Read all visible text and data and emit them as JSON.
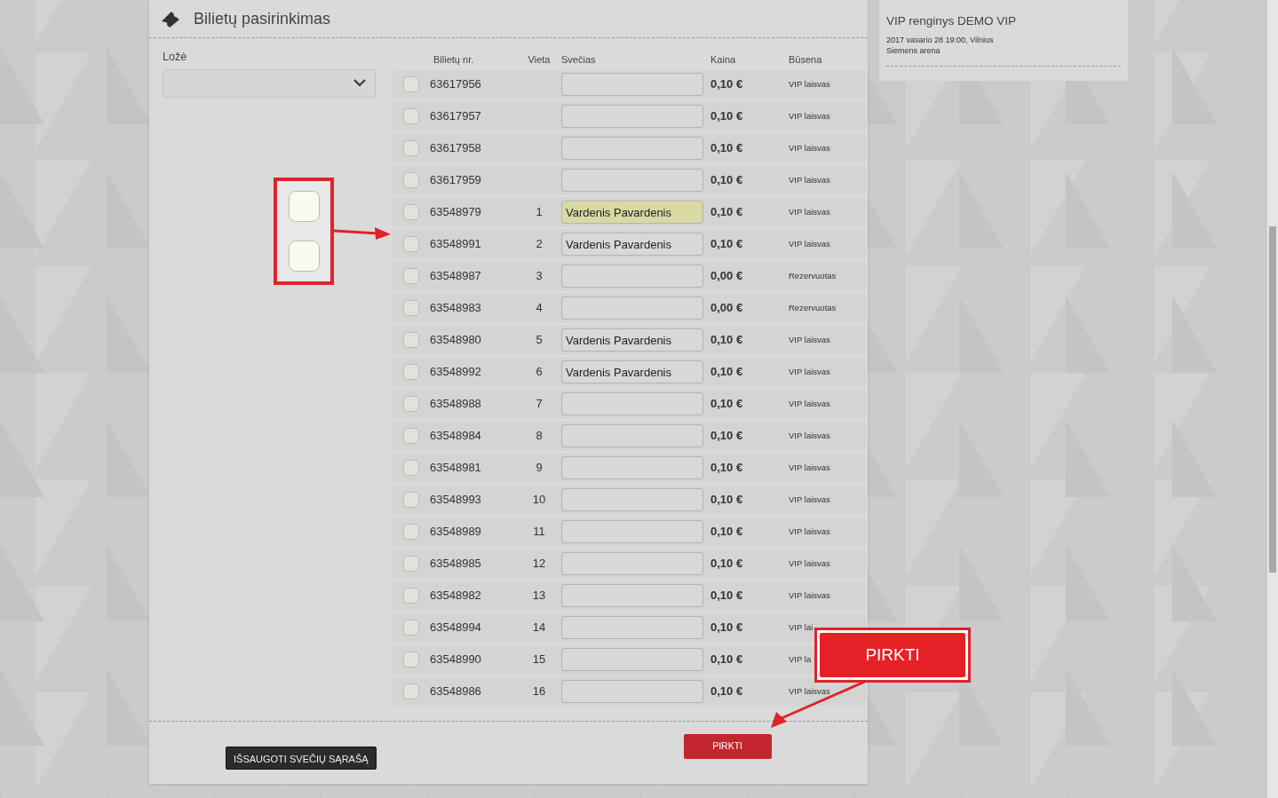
{
  "header": {
    "title": "Bilietų pasirinkimas"
  },
  "loze": {
    "label": "Ložė"
  },
  "table": {
    "columns": [
      "Bilietų nr.",
      "Vieta",
      "Svečias",
      "Kaina",
      "Būsena"
    ],
    "rows": [
      {
        "ticket": "63617956",
        "checked": false,
        "highlighted": false,
        "price": "0,10 €",
        "status": "VIP laisvas"
      },
      {
        "ticket": "63617957",
        "checked": false,
        "highlighted": false,
        "price": "0,10 €",
        "status": "VIP laisvas"
      },
      {
        "ticket": "63617958",
        "checked": false,
        "highlighted": false,
        "price": "0,10 €",
        "status": "VIP laisvas"
      },
      {
        "ticket": "63617959",
        "checked": false,
        "highlighted": false,
        "price": "0,10 €",
        "status": "VIP laisvas"
      },
      {
        "ticket": "63548979",
        "seat": "1",
        "guest": "Vardenis Pavardenis",
        "checked": false,
        "highlighted": true,
        "price": "0,10 €",
        "status": "VIP laisvas"
      },
      {
        "ticket": "63548991",
        "seat": "2",
        "guest": "Vardenis Pavardenis",
        "checked": false,
        "highlighted": false,
        "price": "0,10 €",
        "status": "VIP laisvas"
      },
      {
        "ticket": "63548987",
        "seat": "3",
        "checked": false,
        "highlighted": false,
        "price": "0,00 €",
        "status": "Rezervuotas"
      },
      {
        "ticket": "63548983",
        "seat": "4",
        "checked": false,
        "highlighted": false,
        "price": "0,00 €",
        "status": "Rezervuotas"
      },
      {
        "ticket": "63548980",
        "seat": "5",
        "guest": "Vardenis Pavardenis",
        "checked": false,
        "highlighted": false,
        "price": "0,10 €",
        "status": "VIP laisvas"
      },
      {
        "ticket": "63548992",
        "seat": "6",
        "guest": "Vardenis Pavardenis",
        "checked": false,
        "highlighted": false,
        "price": "0,10 €",
        "status": "VIP laisvas"
      },
      {
        "ticket": "63548988",
        "seat": "7",
        "checked": false,
        "highlighted": false,
        "price": "0,10 €",
        "status": "VIP laisvas"
      },
      {
        "ticket": "63548984",
        "seat": "8",
        "checked": false,
        "highlighted": false,
        "price": "0,10 €",
        "status": "VIP laisvas"
      },
      {
        "ticket": "63548981",
        "seat": "9",
        "checked": false,
        "highlighted": false,
        "price": "0,10 €",
        "status": "VIP laisvas"
      },
      {
        "ticket": "63548993",
        "seat": "10",
        "checked": false,
        "highlighted": false,
        "price": "0,10 €",
        "status": "VIP laisvas"
      },
      {
        "ticket": "63548989",
        "seat": "11",
        "checked": false,
        "highlighted": false,
        "price": "0,10 €",
        "status": "VIP laisvas"
      },
      {
        "ticket": "63548985",
        "seat": "12",
        "checked": false,
        "highlighted": false,
        "price": "0,10 €",
        "status": "VIP laisvas"
      },
      {
        "ticket": "63548982",
        "seat": "13",
        "checked": false,
        "highlighted": false,
        "price": "0,10 €",
        "status": "VIP laisvas"
      },
      {
        "ticket": "63548994",
        "seat": "14",
        "checked": false,
        "highlighted": false,
        "price": "0,10 €",
        "status": "VIP lai"
      },
      {
        "ticket": "63548990",
        "seat": "15",
        "checked": false,
        "highlighted": false,
        "price": "0,10 €",
        "status": "VIP la"
      },
      {
        "ticket": "63548986",
        "seat": "16",
        "checked": false,
        "highlighted": false,
        "price": "0,10 €",
        "status": "VIP laisvas"
      }
    ]
  },
  "footer": {
    "save_button": "IŠSAUGOTI SVEČIŲ SĄRAŠĄ",
    "buy_button": "PIRKTI"
  },
  "event": {
    "title": "VIP renginys DEMO VIP",
    "details": "2017 vasario 28 19:00, Vilnius Siemens arena"
  },
  "annotations": {
    "zoom_checkboxes": [
      {
        "checked": false
      },
      {
        "checked": false
      }
    ],
    "buy_callout": "PIRKTI"
  }
}
